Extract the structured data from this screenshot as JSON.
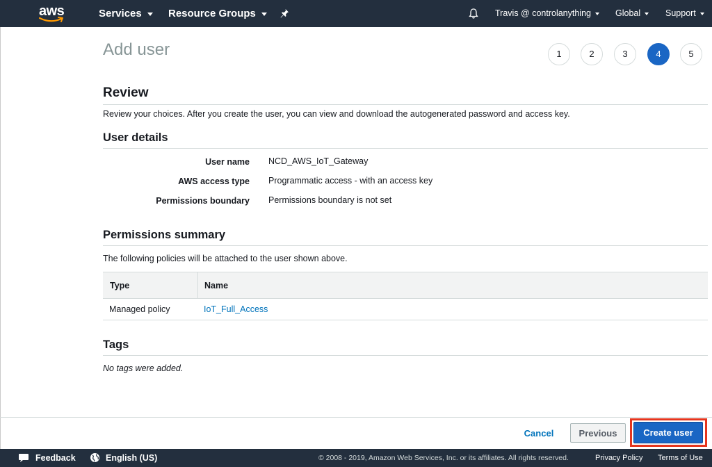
{
  "nav": {
    "logo_text": "aws",
    "services_label": "Services",
    "resource_groups_label": "Resource Groups",
    "user_label": "Travis @ controlanything",
    "region_label": "Global",
    "support_label": "Support"
  },
  "page": {
    "title": "Add user"
  },
  "steps": [
    "1",
    "2",
    "3",
    "4",
    "5"
  ],
  "active_step": "4",
  "review": {
    "title": "Review",
    "description": "Review your choices. After you create the user, you can view and download the autogenerated password and access key."
  },
  "user_details": {
    "title": "User details",
    "rows": [
      {
        "label": "User name",
        "value": "NCD_AWS_IoT_Gateway"
      },
      {
        "label": "AWS access type",
        "value": "Programmatic access - with an access key"
      },
      {
        "label": "Permissions boundary",
        "value": "Permissions boundary is not set"
      }
    ]
  },
  "permissions": {
    "title": "Permissions summary",
    "description": "The following policies will be attached to the user shown above.",
    "columns": [
      "Type",
      "Name"
    ],
    "rows": [
      {
        "type": "Managed policy",
        "name": "IoT_Full_Access"
      }
    ]
  },
  "tags": {
    "title": "Tags",
    "empty_text": "No tags were added."
  },
  "actions": {
    "cancel_label": "Cancel",
    "previous_label": "Previous",
    "create_label": "Create user"
  },
  "footer": {
    "feedback_label": "Feedback",
    "language_label": "English (US)",
    "copyright": "© 2008 - 2019, Amazon Web Services, Inc. or its affiliates. All rights reserved.",
    "privacy_label": "Privacy Policy",
    "terms_label": "Terms of Use"
  },
  "colors": {
    "nav_bg": "#232f3e",
    "primary": "#1a66c4",
    "link": "#0073bb",
    "highlight": "#e5351e"
  }
}
